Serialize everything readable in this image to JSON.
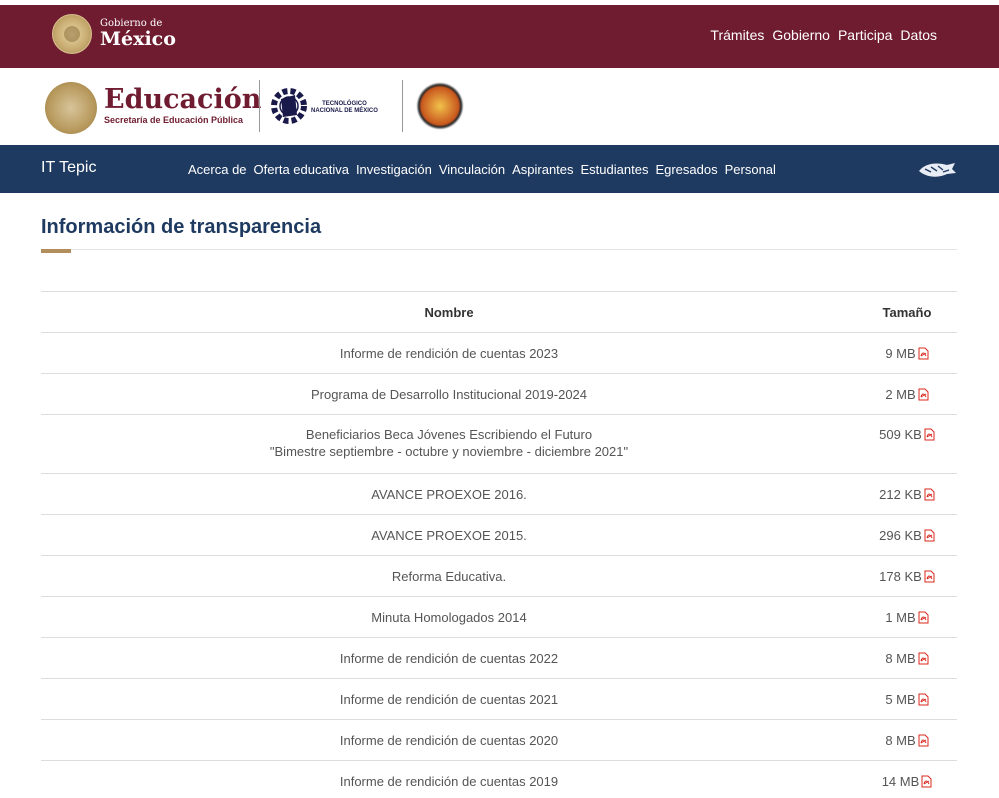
{
  "gov_header": {
    "small_text": "Gobierno de",
    "big_text": "México",
    "nav": [
      "Trámites",
      "Gobierno",
      "Participa",
      "Datos"
    ]
  },
  "logos": {
    "edu_title": "Educación",
    "edu_subtitle": "Secretaría de Educación Pública",
    "tecnm_line1": "TECNOLÓGICO",
    "tecnm_line2": "NACIONAL DE MÉXICO"
  },
  "it_nav": {
    "brand": "IT Tepic",
    "items": [
      "Acerca de",
      "Oferta educativa",
      "Investigación",
      "Vinculación",
      "Aspirantes",
      "Estudiantes",
      "Egresados",
      "Personal"
    ]
  },
  "page": {
    "title": "Información de transparencia"
  },
  "table": {
    "headers": {
      "name": "Nombre",
      "size": "Tamaño"
    },
    "rows": [
      {
        "name": "Informe de rendición de cuentas 2023",
        "size": "9 MB"
      },
      {
        "name": "Programa de Desarrollo Institucional 2019-2024",
        "size": "2 MB"
      },
      {
        "name": "Beneficiarios Beca Jóvenes Escribiendo el Futuro",
        "name_line2": "\"Bimestre septiembre - octubre y noviembre - diciembre 2021\"",
        "size": "509 KB"
      },
      {
        "name": "AVANCE PROEXOE 2016.",
        "size": "212 KB"
      },
      {
        "name": "AVANCE PROEXOE 2015.",
        "size": "296 KB"
      },
      {
        "name": "Reforma Educativa.",
        "size": "178 KB"
      },
      {
        "name": "Minuta Homologados 2014",
        "size": "1 MB"
      },
      {
        "name": "Informe de rendición de cuentas 2022",
        "size": "8 MB"
      },
      {
        "name": "Informe de rendición de cuentas 2021",
        "size": "5 MB"
      },
      {
        "name": "Informe de rendición de cuentas 2020",
        "size": "8 MB"
      },
      {
        "name": "Informe de rendición de cuentas 2019",
        "size": "14 MB"
      }
    ]
  },
  "colors": {
    "gov_bar": "#6f1c31",
    "nav_blue": "#1f3a60",
    "accent_gold": "#b38e5d",
    "pdf_red": "#d9271e"
  },
  "icons": {
    "gov_seal": "mexico-coat-of-arms-icon",
    "file": "pdf-icon"
  }
}
